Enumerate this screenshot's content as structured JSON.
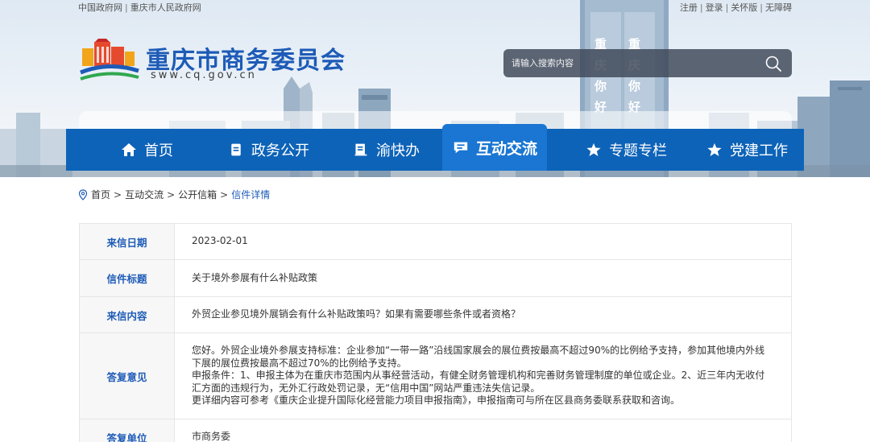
{
  "topbar": {
    "links_left": [
      "中国政府网",
      "重庆市人民政府网"
    ],
    "links_right": [
      "注册",
      "登录",
      "关怀版",
      "无障碍"
    ]
  },
  "header": {
    "title": "重庆市商务委员会",
    "domain": "sww.cq.gov.cn",
    "search_placeholder": "请输入搜索内容",
    "billboard_text": [
      "重",
      "庆",
      "你",
      "好",
      "重",
      "庆",
      "你",
      "好"
    ]
  },
  "nav": {
    "items": [
      {
        "label": "首页",
        "icon": "home-icon"
      },
      {
        "label": "政务公开",
        "icon": "document-icon"
      },
      {
        "label": "渝快办",
        "icon": "list-icon"
      },
      {
        "label": "互动交流",
        "icon": "chat-icon",
        "active": true
      },
      {
        "label": "专题专栏",
        "icon": "star-icon"
      },
      {
        "label": "党建工作",
        "icon": "star-icon"
      }
    ]
  },
  "breadcrumb": {
    "items": [
      "首页",
      "互动交流",
      "公开信箱"
    ],
    "current": "信件详情"
  },
  "letter": {
    "date_label": "来信日期",
    "date": "2023-02-01",
    "title_label": "信件标题",
    "title": "关于境外参展有什么补贴政策",
    "content_label": "来信内容",
    "content": "外贸企业参见境外展销会有什么补贴政策吗？如果有需要哪些条件或者资格？",
    "reply_label": "答复意见",
    "reply_lines": [
      "您好。外贸企业境外参展支持标准：企业参加“一带一路”沿线国家展会的展位费按最高不超过90%的比例给予支持，参加其他境内外线下展的展位费按最高不超过70%的比例给予支持。",
      "申报条件：1、申报主体为在重庆市范围内从事经营活动，有健全财务管理机构和完善财务管理制度的单位或企业。2、近三年内无收付汇方面的违规行为，无外汇行政处罚记录，无“信用中国”网站严重违法失信记录。",
      "更详细内容可参考《重庆企业提升国际化经营能力项目申报指南》，申报指南可与所在区县商务委联系获取和咨询。"
    ],
    "unit_label": "答复单位",
    "unit": "市商务委"
  },
  "colors": {
    "brand_blue": "#1d5bb7",
    "nav_blue": "#0d63b8",
    "nav_active": "#1a76d2"
  }
}
